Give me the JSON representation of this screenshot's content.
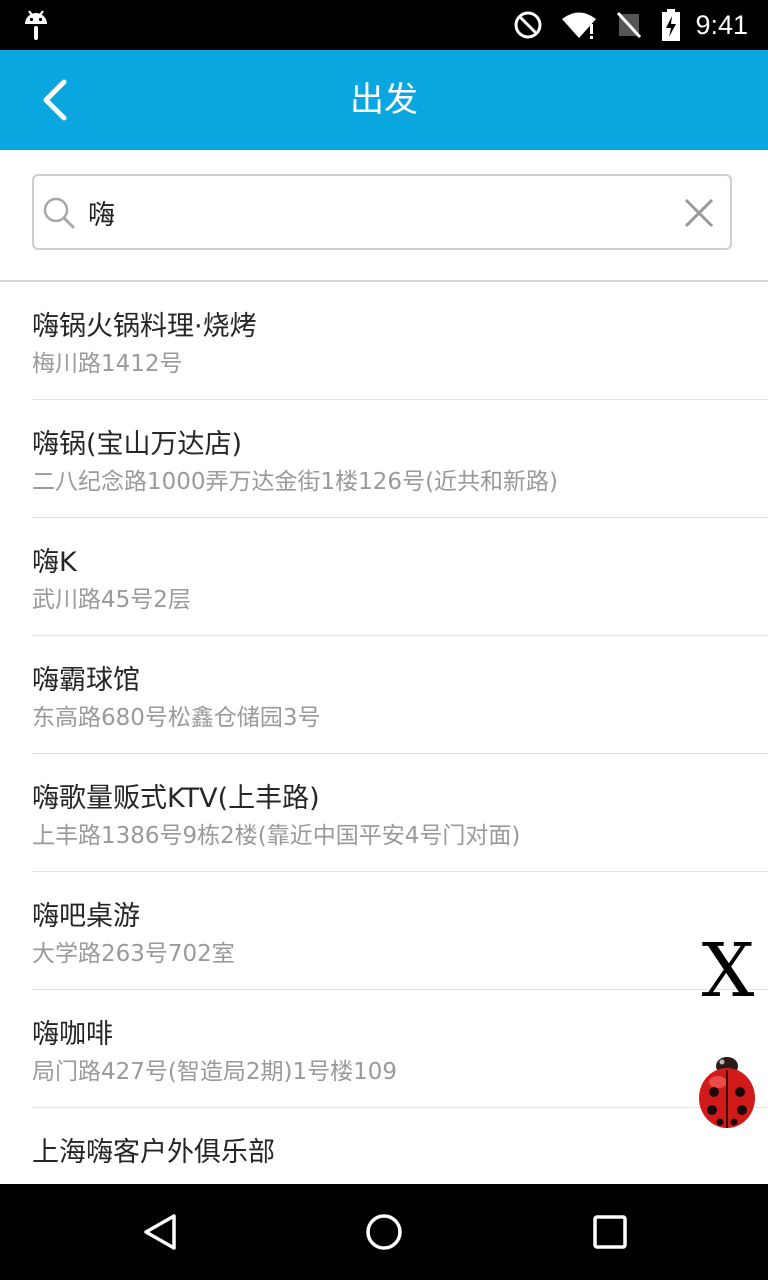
{
  "status_bar": {
    "time": "9:41",
    "icons": [
      "android-icon",
      "do-not-disturb-icon",
      "wifi-icon",
      "no-signal-icon",
      "battery-charging-icon"
    ]
  },
  "app_bar": {
    "title": "出发",
    "back_icon": "chevron-left-icon",
    "background_color": "#0aa6e0"
  },
  "search": {
    "value": "嗨",
    "icon": "search-icon",
    "clear_icon": "close-icon"
  },
  "results": [
    {
      "name": "嗨锅火锅料理·烧烤",
      "address": "梅川路1412号"
    },
    {
      "name": "嗨锅(宝山万达店)",
      "address": "二八纪念路1000弄万达金街1楼126号(近共和新路)"
    },
    {
      "name": "嗨K",
      "address": "武川路45号2层"
    },
    {
      "name": "嗨霸球馆",
      "address": "东高路680号松鑫仓储园3号"
    },
    {
      "name": "嗨歌量贩式KTV(上丰路)",
      "address": "上丰路1386号9栋2楼(靠近中国平安4号门对面)"
    },
    {
      "name": "嗨吧桌游",
      "address": "大学路263号702室"
    },
    {
      "name": "嗨咖啡",
      "address": "局门路427号(智造局2期)1号楼109"
    },
    {
      "name": "上海嗨客户外俱乐部",
      "address": ""
    }
  ],
  "overlay": {
    "close_label": "X",
    "bug_icon": "ladybug-icon"
  },
  "nav_bar": {
    "icons": [
      "back-triangle-icon",
      "home-circle-icon",
      "recents-square-icon"
    ]
  }
}
